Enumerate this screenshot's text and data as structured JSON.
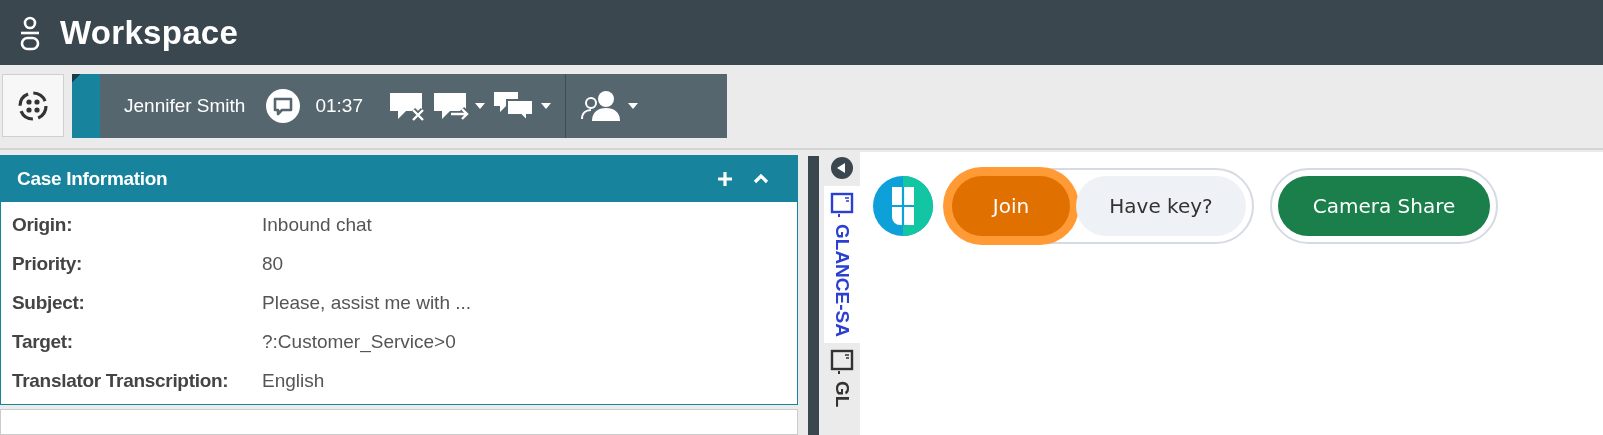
{
  "window": {
    "title": "Workspace"
  },
  "interaction": {
    "contact": "Jennifer Smith",
    "timer": "01:37"
  },
  "case_information": {
    "title": "Case Information",
    "expanded": true,
    "fields": [
      {
        "label": "Origin:",
        "value": "Inbound chat"
      },
      {
        "label": "Priority:",
        "value": "80"
      },
      {
        "label": "Subject:",
        "value": "Please, assist me with ..."
      },
      {
        "label": "Target:",
        "value": "?:Customer_Service>0"
      },
      {
        "label": "Translator Transcription:",
        "value": "English"
      }
    ]
  },
  "side_tabs": [
    {
      "label": "GLANCE-SA",
      "selected": true
    },
    {
      "label": "GL",
      "selected": false
    }
  ],
  "glance": {
    "buttons": [
      {
        "label": "Join",
        "kind": "primary",
        "focused": true
      },
      {
        "label": "Have key?",
        "kind": "secondary",
        "focused": false
      },
      {
        "label": "Camera Share",
        "kind": "share",
        "focused": false
      }
    ]
  }
}
